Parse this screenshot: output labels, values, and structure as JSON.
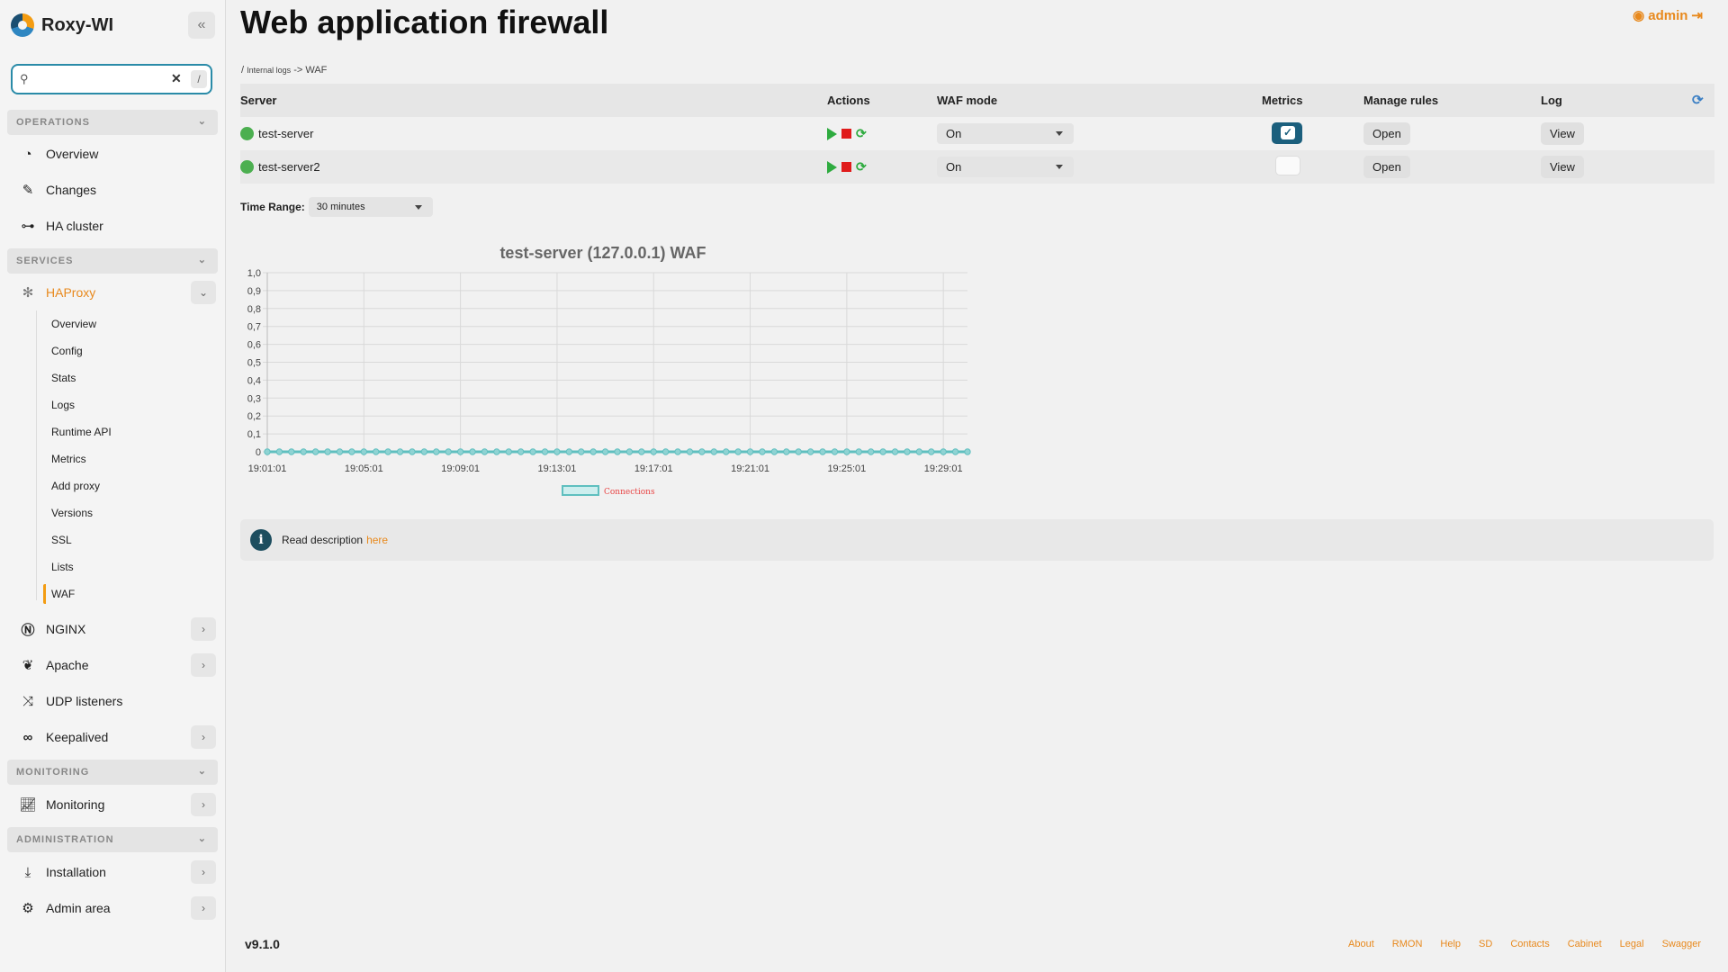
{
  "app": {
    "name": "Roxy-WI",
    "version": "v9.1.0"
  },
  "search": {
    "value": "",
    "clear_label": "✕",
    "shortcut": "/"
  },
  "sidebar": {
    "sections": [
      {
        "label": "OPERATIONS"
      },
      {
        "label": "SERVICES"
      },
      {
        "label": "MONITORING"
      },
      {
        "label": "ADMINISTRATION"
      }
    ],
    "items": {
      "overview": "Overview",
      "changes": "Changes",
      "ha_cluster": "HA cluster",
      "haproxy": "HAProxy",
      "nginx": "NGINX",
      "apache": "Apache",
      "udp": "UDP listeners",
      "keepalived": "Keepalived",
      "monitoring": "Monitoring",
      "installation": "Installation",
      "admin_area": "Admin area"
    },
    "haproxy_sub": [
      "Overview",
      "Config",
      "Stats",
      "Logs",
      "Runtime API",
      "Metrics",
      "Add proxy",
      "Versions",
      "SSL",
      "Lists",
      "WAF"
    ]
  },
  "page": {
    "title": "Web application firewall",
    "user": "admin"
  },
  "breadcrumb": {
    "sep": "/",
    "parent": "Internal logs",
    "arrow": "->",
    "current": "WAF"
  },
  "table": {
    "headers": {
      "server": "Server",
      "actions": "Actions",
      "mode": "WAF mode",
      "metrics": "Metrics",
      "rules": "Manage rules",
      "log": "Log"
    },
    "rows": [
      {
        "server": "test-server",
        "mode": "On",
        "metrics": true,
        "rules": "Open",
        "log": "View"
      },
      {
        "server": "test-server2",
        "mode": "On",
        "metrics": false,
        "rules": "Open",
        "log": "View"
      }
    ]
  },
  "time_range": {
    "label": "Time Range:",
    "value": "30 minutes"
  },
  "chart_data": {
    "type": "line",
    "title": "test-server (127.0.0.1) WAF",
    "xlabel": "",
    "ylabel": "",
    "ylim": [
      0,
      1
    ],
    "yticks": [
      "0",
      "0,1",
      "0,2",
      "0,3",
      "0,4",
      "0,5",
      "0,6",
      "0,7",
      "0,8",
      "0,9",
      "1,0"
    ],
    "x_tick_labels": [
      "19:01:01",
      "19:05:01",
      "19:09:01",
      "19:13:01",
      "19:17:01",
      "19:21:01",
      "19:25:01",
      "19:29:01"
    ],
    "x_range_minutes": [
      0,
      29
    ],
    "series": [
      {
        "name": "Connections",
        "color": "#5fbfbf",
        "values": [
          0,
          0,
          0,
          0,
          0,
          0,
          0,
          0,
          0,
          0,
          0,
          0,
          0,
          0,
          0,
          0,
          0,
          0,
          0,
          0,
          0,
          0,
          0,
          0,
          0,
          0,
          0,
          0,
          0,
          0,
          0,
          0,
          0,
          0,
          0,
          0,
          0,
          0,
          0,
          0,
          0,
          0,
          0,
          0,
          0,
          0,
          0,
          0,
          0,
          0,
          0,
          0,
          0,
          0,
          0,
          0,
          0,
          0,
          0
        ]
      }
    ],
    "grid": true,
    "legend": "bottom"
  },
  "info": {
    "text": "Read description",
    "link": "here",
    "icon": "i"
  },
  "footer": [
    "About",
    "RMON",
    "Help",
    "SD",
    "Contacts",
    "Cabinet",
    "Legal",
    "Swagger"
  ],
  "colors": {
    "accent": "#e8891d",
    "teal": "#1b5f7d",
    "series": "#5fbfbf"
  }
}
